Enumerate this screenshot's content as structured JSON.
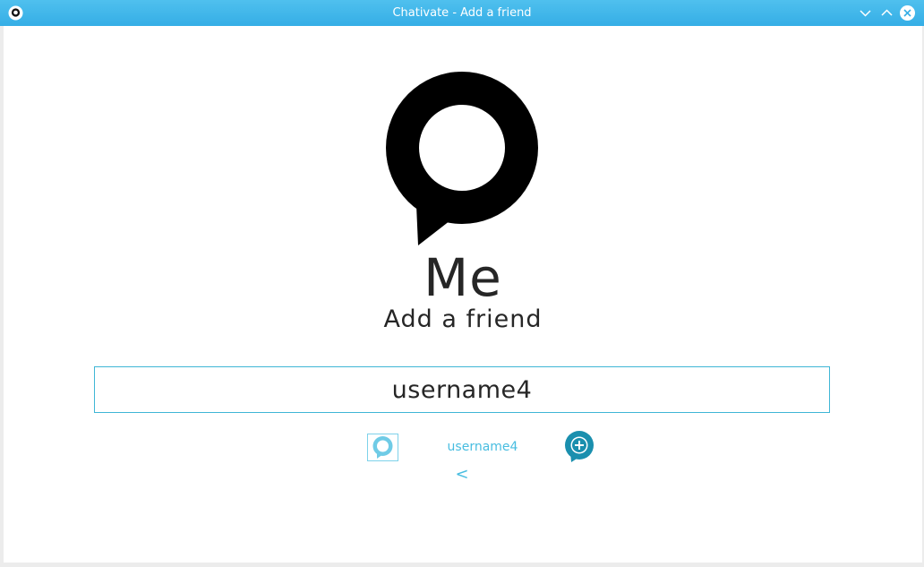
{
  "window": {
    "title": "Chativate - Add a friend",
    "accent_color": "#35aee6"
  },
  "profile": {
    "name": "Me",
    "subtitle": "Add a friend"
  },
  "search": {
    "value": "username4"
  },
  "result": {
    "username": "username4",
    "add_icon": "add-friend-icon",
    "avatar_icon": "chat-bubble-icon"
  },
  "navigation": {
    "back_label": "<"
  },
  "colors": {
    "accent": "#48bde0",
    "add_button": "#1a8fae",
    "text": "#262626"
  }
}
